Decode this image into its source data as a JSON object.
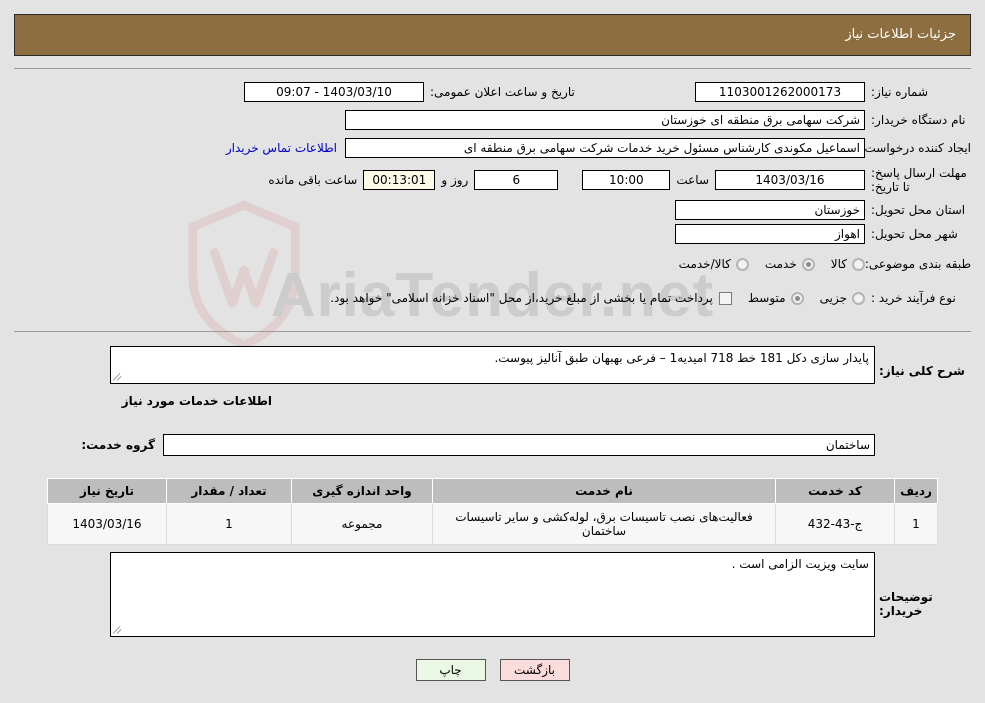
{
  "header": {
    "title": "جزئیات اطلاعات نیاز",
    "bg_color": "#8d6e41"
  },
  "form": {
    "need_number_label": "شماره نیاز:",
    "need_number_value": "1103001262000173",
    "announce_datetime_label": "تاریخ و ساعت اعلان عمومی:",
    "announce_datetime_value": "09:07 - 1403/03/10",
    "buyer_org_label": "نام دستگاه خریدار:",
    "buyer_org_value": "شرکت سهامی برق منطقه ای خوزستان",
    "creator_label": "ایجاد کننده درخواست:",
    "creator_value": "اسماعیل مکوندی کارشناس مسئول خرید خدمات شرکت سهامی برق منطقه ای",
    "contact_link": "اطلاعات تماس خریدار",
    "deadline_label": "مهلت ارسال پاسخ: تا تاریخ:",
    "deadline_date": "1403/03/16",
    "deadline_hour_label": "ساعت",
    "deadline_hour": "10:00",
    "days_value": "6",
    "days_label": "روز و",
    "countdown_value": "00:13:01",
    "countdown_label": "ساعت باقی مانده",
    "province_label": "استان محل تحویل:",
    "province_value": "خوزستان",
    "city_label": "شهر محل تحویل:",
    "city_value": "اهواز",
    "category_label": "طبقه بندی موضوعی:",
    "category_options": [
      {
        "label": "کالا",
        "selected": false
      },
      {
        "label": "خدمت",
        "selected": true
      },
      {
        "label": "کالا/خدمت",
        "selected": false
      }
    ],
    "process_label": "نوع فرآیند خرید :",
    "process_options": [
      {
        "label": "جزیی",
        "selected": false
      },
      {
        "label": "متوسط",
        "selected": true
      }
    ],
    "treasury_checkbox_checked": false,
    "treasury_note": "پرداخت تمام یا بخشی از مبلغ خرید،از محل \"اسناد خزانه اسلامی\" خواهد بود."
  },
  "description": {
    "label": "شرح کلی نیاز:",
    "value": "پایدار سازی دکل 181 خط 718  امیدیه1 – فرعی بهبهان طبق آنالیز پیوست."
  },
  "services_section": {
    "heading": "اطلاعات خدمات مورد نیاز",
    "group_label": "گروه خدمت:",
    "group_value": "ساختمان"
  },
  "table": {
    "headers": [
      "ردیف",
      "کد خدمت",
      "نام خدمت",
      "واحد اندازه گیری",
      "تعداد / مقدار",
      "تاریخ نیاز"
    ],
    "rows": [
      {
        "row": "1",
        "code": "ج-43-432",
        "name": "فعالیت‌های نصب تاسیسات برق، لوله‌کشی و سایر تاسیسات ساختمان",
        "unit": "مجموعه",
        "qty": "1",
        "date": "1403/03/16"
      }
    ]
  },
  "buyer_notes": {
    "label": "توضیحات خریدار:",
    "value": "سایت ویزیت الزامی است  ."
  },
  "buttons": {
    "print": "چاپ",
    "back": "بازگشت"
  },
  "watermark": {
    "text": "AriaTender.net"
  }
}
